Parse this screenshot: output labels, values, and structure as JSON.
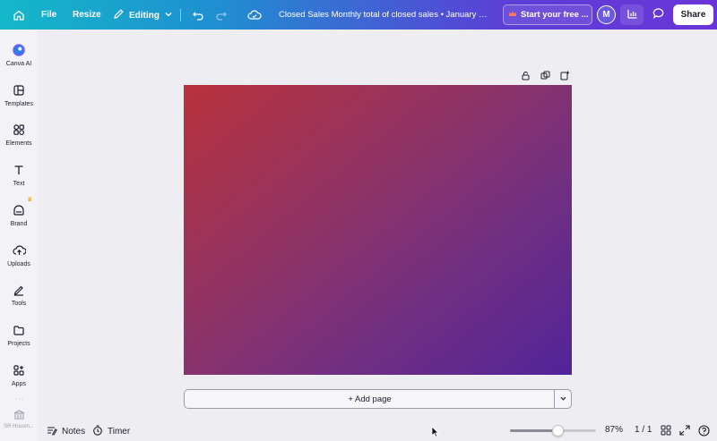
{
  "topbar": {
    "file_label": "File",
    "resize_label": "Resize",
    "editing_label": "Editing",
    "document_title": "Closed Sales Monthly total of closed sales • January 2...",
    "trial_label": "Start your free ...",
    "avatar_initial": "M",
    "share_label": "Share"
  },
  "sidebar": {
    "items": [
      {
        "label": "Canva AI",
        "icon": "canva-ai-icon"
      },
      {
        "label": "Templates",
        "icon": "templates-icon"
      },
      {
        "label": "Elements",
        "icon": "elements-icon"
      },
      {
        "label": "Text",
        "icon": "text-icon"
      },
      {
        "label": "Brand",
        "icon": "brand-icon"
      },
      {
        "label": "Uploads",
        "icon": "uploads-icon"
      },
      {
        "label": "Tools",
        "icon": "tools-icon"
      },
      {
        "label": "Projects",
        "icon": "projects-icon"
      },
      {
        "label": "Apps",
        "icon": "apps-icon"
      }
    ],
    "bottom_item_label": "SR Housin..."
  },
  "canvas": {
    "gradient_start": "#b8323b",
    "gradient_end": "#51249a",
    "add_page_label": "+ Add page"
  },
  "bottombar": {
    "notes_label": "Notes",
    "timer_label": "Timer",
    "zoom_level": "87%",
    "zoom_fraction": 0.55,
    "page_counter": "1 / 1"
  },
  "colors": {
    "accent": "#5b3fd6",
    "topbar_start": "#14b8c9",
    "topbar_end": "#6b34d8"
  }
}
